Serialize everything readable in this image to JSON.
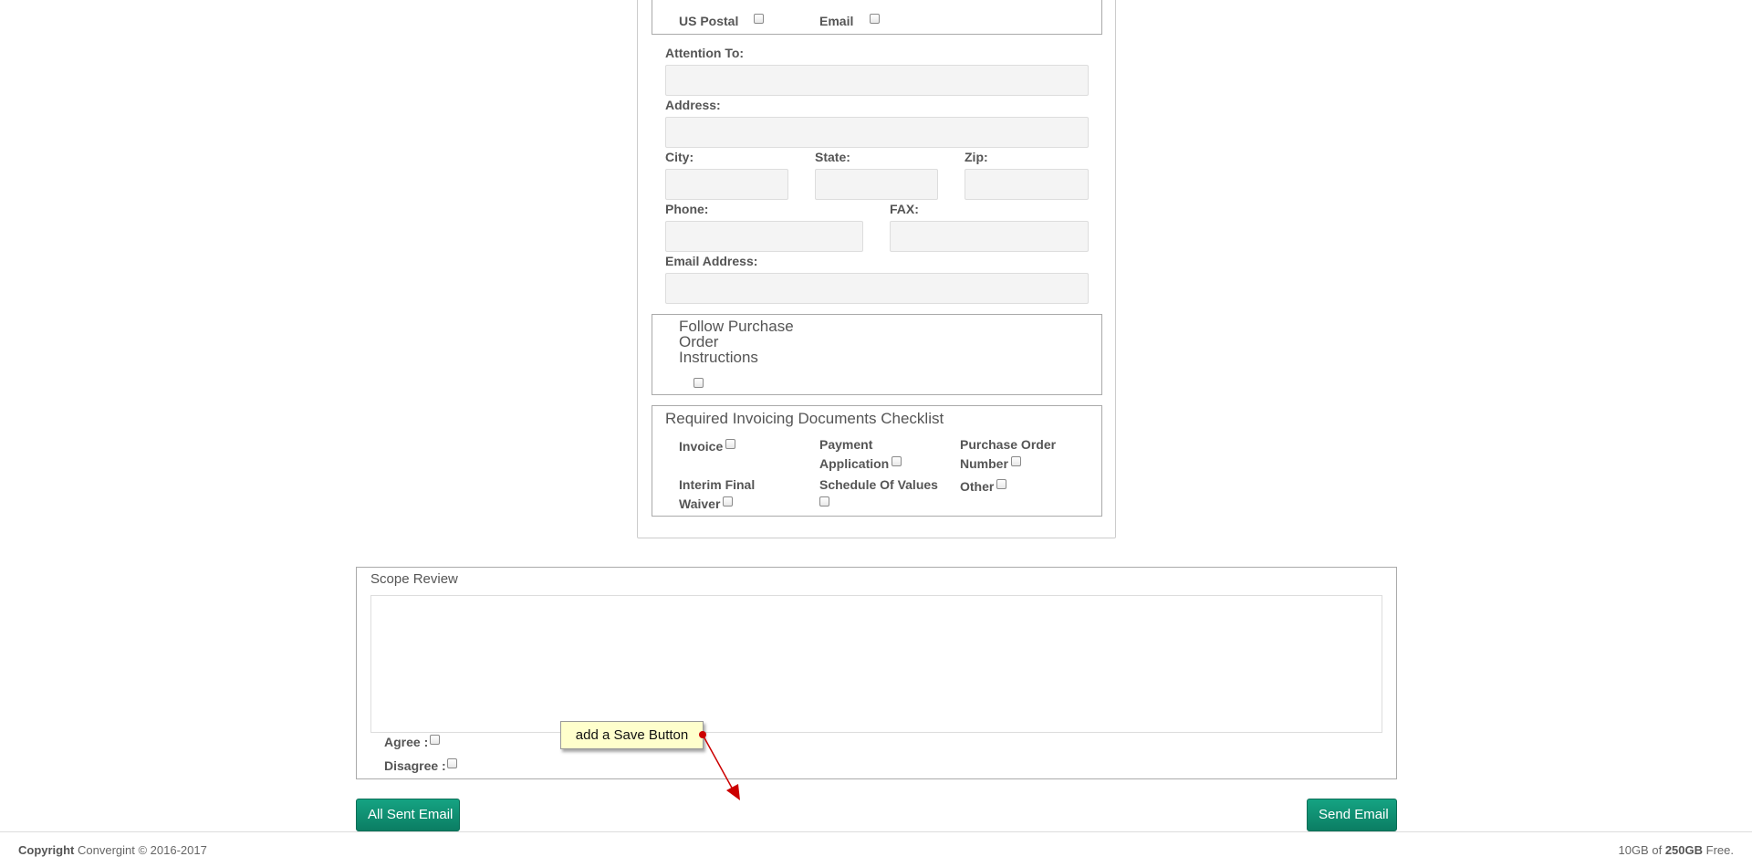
{
  "delivery": {
    "us_postal_label": "US Postal",
    "email_label": "Email"
  },
  "contact": {
    "attention_label": "Attention To:",
    "attention_value": "",
    "address_label": "Address:",
    "address_value": "",
    "city_label": "City:",
    "city_value": "",
    "state_label": "State:",
    "state_value": "",
    "zip_label": "Zip:",
    "zip_value": "",
    "phone_label": "Phone:",
    "phone_value": "",
    "fax_label": "FAX:",
    "fax_value": "",
    "email_address_label": "Email Address:",
    "email_address_value": ""
  },
  "po_instructions": {
    "title": "Follow Purchase Order Instructions"
  },
  "checklist": {
    "title": "Required Invoicing Documents Checklist",
    "invoice": "Invoice",
    "payment_application": "Payment Application",
    "purchase_order_number": "Purchase Order Number",
    "interim_final_waiver": "Interim Final Waiver",
    "schedule_of_values": "Schedule Of Values",
    "other": "Other"
  },
  "scope": {
    "title": "Scope Review",
    "text": "",
    "agree_label": "Agree :",
    "disagree_label": "Disagree :"
  },
  "annotation": {
    "note": "add a Save Button",
    "color": "#cc0000"
  },
  "buttons": {
    "all_sent_email": "All Sent Email",
    "send_email": "Send Email",
    "color": "#0f8f70"
  },
  "footer": {
    "copyright_bold": "Copyright",
    "copyright_text": "Convergint © 2016-2017",
    "storage_used": "10GB",
    "storage_of": "of",
    "storage_total": "250GB",
    "storage_free": "Free."
  }
}
